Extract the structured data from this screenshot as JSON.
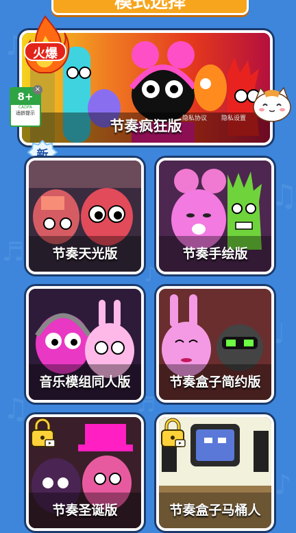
{
  "header": {
    "title": "模式选择"
  },
  "featured": {
    "label": "节奏疯狂版",
    "hot_badge": "火爆",
    "privacy_policy": "隐私协议",
    "privacy_settings": "隐私设置",
    "age_rating": "8+",
    "age_org": "CADPA",
    "age_hint": "适龄提示"
  },
  "new_badge": "新",
  "games": [
    {
      "label": "节奏天光版",
      "locked": false
    },
    {
      "label": "节奏手绘版",
      "locked": false
    },
    {
      "label": "音乐模组同人版",
      "locked": false
    },
    {
      "label": "节奏盒子简约版",
      "locked": false
    },
    {
      "label": "节奏圣诞版",
      "locked": true
    },
    {
      "label": "节奏盒子马桶人",
      "locked": true
    }
  ],
  "colors": {
    "background": "#3d86dc",
    "accent": "#f7a51c",
    "card_border": "#ffffff"
  }
}
